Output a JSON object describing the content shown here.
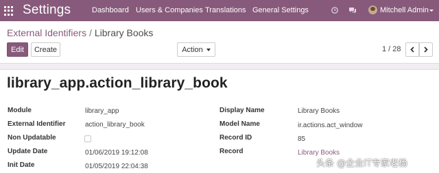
{
  "navbar": {
    "app_title": "Settings",
    "menu": [
      "Dashboard",
      "Users & Companies",
      "Translations",
      "General Settings"
    ],
    "user_name": "Mitchell Admin",
    "icons": [
      "apps-grid-icon",
      "clock-icon",
      "chat-icon"
    ],
    "background_color": "#875a7b"
  },
  "breadcrumb": {
    "parent": "External Identifiers",
    "separator": "/",
    "current": "Library Books"
  },
  "buttons": {
    "edit": "Edit",
    "create": "Create",
    "action": "Action"
  },
  "pager": {
    "value": "1 / 28",
    "prev_icon": "chevron-left-icon",
    "next_icon": "chevron-right-icon"
  },
  "record": {
    "title": "library_app.action_library_book",
    "left_fields": [
      {
        "label": "Module",
        "value": "library_app"
      },
      {
        "label": "External Identifier",
        "value": "action_library_book"
      },
      {
        "label": "Non Updatable",
        "value": ""
      },
      {
        "label": "Update Date",
        "value": "01/06/2019 19:12:08"
      },
      {
        "label": "Init Date",
        "value": "01/05/2019 22:04:38"
      }
    ],
    "right_fields": [
      {
        "label": "Display Name",
        "value": "Library Books"
      },
      {
        "label": "Model Name",
        "value": "ir.actions.act_window"
      },
      {
        "label": "Record ID",
        "value": "85"
      },
      {
        "label": "Record",
        "value": "Library Books"
      }
    ]
  },
  "watermark": "头条 @企业IT专家老杨",
  "colors": {
    "primary": "#875a7b",
    "link": "#875a7b"
  }
}
